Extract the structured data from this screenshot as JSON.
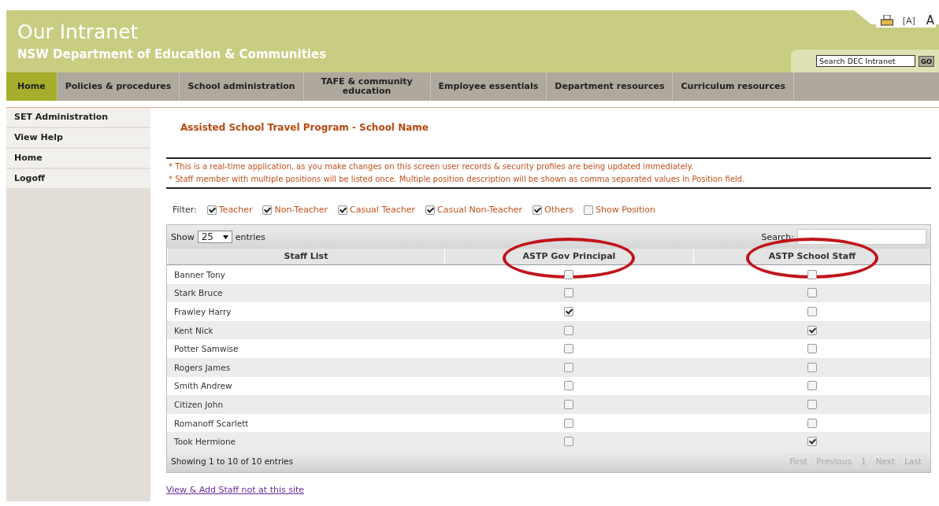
{
  "header": {
    "title": "Our Intranet",
    "subtitle": "NSW Department of Education & Communities",
    "tools": [
      "[A]",
      "A"
    ],
    "search": {
      "placeholder": "Search DEC Intranet",
      "button": "GO"
    }
  },
  "nav": [
    {
      "label": "Home",
      "selected": true
    },
    {
      "label": "Policies & procedures",
      "selected": false
    },
    {
      "label": "School administration",
      "selected": false
    },
    {
      "label": "TAFE & community education",
      "selected": false
    },
    {
      "label": "Employee essentials",
      "selected": false
    },
    {
      "label": "Department resources",
      "selected": false
    },
    {
      "label": "Curriculum resources",
      "selected": false
    }
  ],
  "sidebar": {
    "items": [
      "SET Administration",
      "View Help",
      "Home",
      "Logoff"
    ]
  },
  "page_title": "Assisted School Travel Program - School Name",
  "notices": [
    "* This is a real-time application, as you make changes on this screen user records & security profiles are being updated immediately.",
    "* Staff member with multiple positions will be listed once. Multiple position description will be shown as comma separated values in Position field."
  ],
  "filter": {
    "label": "Filter:",
    "options": [
      {
        "label": "Teacher",
        "checked": true
      },
      {
        "label": "Non-Teacher",
        "checked": true
      },
      {
        "label": "Casual Teacher",
        "checked": true
      },
      {
        "label": "Casual Non-Teacher",
        "checked": true
      },
      {
        "label": "Others",
        "checked": true
      },
      {
        "label": "Show Position",
        "checked": false
      }
    ]
  },
  "table": {
    "show_label": "Show",
    "page_size": "25",
    "entries_label": "entries",
    "search_label": "Search:",
    "columns": [
      {
        "label": "Staff List",
        "circled": false
      },
      {
        "label": "ASTP Gov Principal",
        "circled": true
      },
      {
        "label": "ASTP School Staff",
        "circled": true
      }
    ],
    "rows": [
      {
        "name": "Banner Tony",
        "gov_principal": false,
        "school_staff": false
      },
      {
        "name": "Stark Bruce",
        "gov_principal": false,
        "school_staff": false
      },
      {
        "name": "Frawley Harry",
        "gov_principal": true,
        "school_staff": false
      },
      {
        "name": "Kent Nick",
        "gov_principal": false,
        "school_staff": true
      },
      {
        "name": "Potter Samwise",
        "gov_principal": false,
        "school_staff": false
      },
      {
        "name": "Rogers James",
        "gov_principal": false,
        "school_staff": false
      },
      {
        "name": "Smith Andrew",
        "gov_principal": false,
        "school_staff": false
      },
      {
        "name": "Citizen John",
        "gov_principal": false,
        "school_staff": false
      },
      {
        "name": "Romanoff Scarlett",
        "gov_principal": false,
        "school_staff": false
      },
      {
        "name": "Took Hermione",
        "gov_principal": false,
        "school_staff": true
      }
    ],
    "info": "Showing 1 to 10 of 10 entries",
    "pager": [
      "First",
      "Previous",
      "1",
      "Next",
      "Last"
    ]
  },
  "link": "View & Add Staff not at this site"
}
